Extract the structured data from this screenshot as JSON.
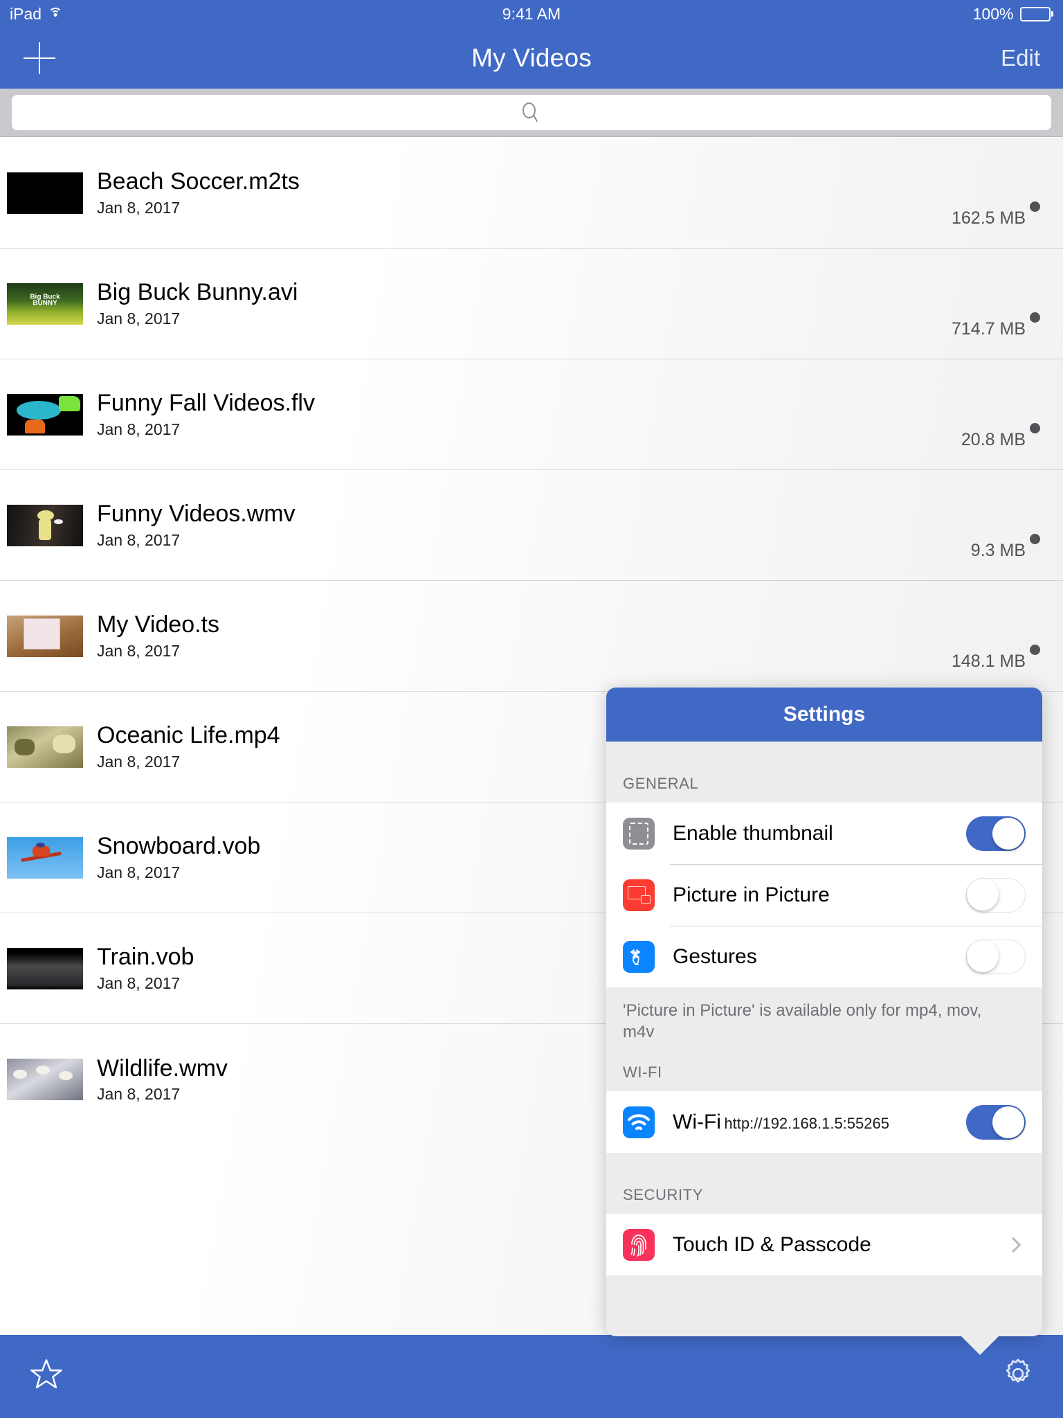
{
  "status_bar": {
    "device": "iPad",
    "wifi_icon": "wifi-icon",
    "time": "9:41 AM",
    "battery_percent": "100%",
    "battery_icon": "battery-full-icon"
  },
  "nav_bar": {
    "add_icon": "plus-icon",
    "title": "My Videos",
    "edit_label": "Edit",
    "background_color": "#4069c5"
  },
  "search": {
    "icon": "search-icon",
    "value": "",
    "placeholder": ""
  },
  "list": {
    "items": [
      {
        "name": "Beach Soccer.m2ts",
        "date": "Jan 8, 2017",
        "size": "162.5 MB",
        "unread": true,
        "thumb": "black"
      },
      {
        "name": "Big Buck Bunny.avi",
        "date": "Jan 8, 2017",
        "size": "714.7 MB",
        "unread": true,
        "thumb": "bigbuckbunny"
      },
      {
        "name": "Funny Fall Videos.flv",
        "date": "Jan 8, 2017",
        "size": "20.8 MB",
        "unread": true,
        "thumb": "trampoline"
      },
      {
        "name": "Funny Videos.wmv",
        "date": "Jan 8, 2017",
        "size": "9.3 MB",
        "unread": true,
        "thumb": "skeleton"
      },
      {
        "name": "My Video.ts",
        "date": "Jan 8, 2017",
        "size": "148.1 MB",
        "unread": true,
        "thumb": "calendar"
      },
      {
        "name": "Oceanic Life.mp4",
        "date": "Jan 8, 2017",
        "size": "",
        "unread": false,
        "thumb": "reef"
      },
      {
        "name": "Snowboard.vob",
        "date": "Jan 8, 2017",
        "size": "",
        "unread": false,
        "thumb": "snowboard"
      },
      {
        "name": "Train.vob",
        "date": "Jan 8, 2017",
        "size": "",
        "unread": false,
        "thumb": "train"
      },
      {
        "name": "Wildlife.wmv",
        "date": "Jan 8, 2017",
        "size": "",
        "unread": false,
        "thumb": "birds"
      }
    ]
  },
  "toolbar": {
    "favorites_icon": "star-icon",
    "settings_icon": "gear-icon",
    "background_color": "#4069c5"
  },
  "settings_popover": {
    "title": "Settings",
    "sections": {
      "general": {
        "header": "GENERAL",
        "rows": [
          {
            "icon": "thumbnail-icon",
            "label": "Enable thumbnail",
            "toggle": "on"
          },
          {
            "icon": "picture-in-picture-icon",
            "label": "Picture in Picture",
            "toggle": "off"
          },
          {
            "icon": "gesture-icon",
            "label": "Gestures",
            "toggle": "off"
          }
        ],
        "footnote": "'Picture in Picture' is available only for mp4, mov, m4v"
      },
      "wifi": {
        "header": "WI-FI",
        "rows": [
          {
            "icon": "wifi-icon",
            "label": "Wi-Fi",
            "sublabel": "http://192.168.1.5:55265",
            "toggle": "on"
          }
        ]
      },
      "security": {
        "header": "SECURITY",
        "rows": [
          {
            "icon": "touch-id-icon",
            "label": "Touch ID & Passcode",
            "accessory": "chevron-right-icon"
          }
        ]
      }
    }
  }
}
